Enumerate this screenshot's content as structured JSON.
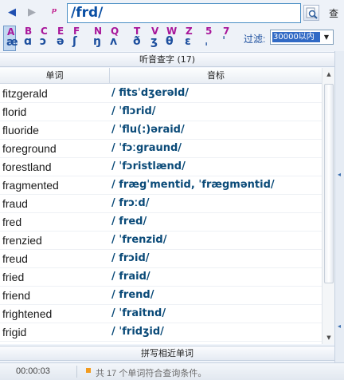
{
  "toolbar": {
    "search_value": "/frd/",
    "query_label": "查"
  },
  "phonetic_keys": [
    {
      "top": "A",
      "bottom": "æ",
      "active": true
    },
    {
      "top": "B",
      "bottom": "ɑ"
    },
    {
      "top": "C",
      "bottom": "ɔ"
    },
    {
      "top": "E",
      "bottom": "ə"
    },
    {
      "top": "F",
      "bottom": "ʃ"
    },
    {
      "top": "N",
      "bottom": "ŋ"
    },
    {
      "top": "Q",
      "bottom": "ʌ"
    },
    {
      "top": "T",
      "bottom": "ð"
    },
    {
      "top": "V",
      "bottom": "ʒ"
    },
    {
      "top": "W",
      "bottom": "θ"
    },
    {
      "top": "Z",
      "bottom": "ε"
    },
    {
      "top": "5",
      "bottom": "ˌ"
    },
    {
      "top": "7",
      "bottom": "ˈ"
    }
  ],
  "filter": {
    "label": "过滤:",
    "selected": "30000以内"
  },
  "results_header": "听音查字 (17)",
  "table": {
    "columns": [
      "单词",
      "音标"
    ],
    "rows": [
      {
        "word": "fitzgerald",
        "phonetic": "/ fitsˈdʒerəld/"
      },
      {
        "word": "florid",
        "phonetic": "/ ˈflɔrid/"
      },
      {
        "word": "fluoride",
        "phonetic": "/ ˈflu(:)əraid/"
      },
      {
        "word": "foreground",
        "phonetic": "/ ˈfɔːgraund/"
      },
      {
        "word": "forestland",
        "phonetic": "/ ˈfɔristlænd/"
      },
      {
        "word": "fragmented",
        "phonetic": "/ frægˈmentid, ˈfrægməntid/"
      },
      {
        "word": "fraud",
        "phonetic": "/ frɔːd/"
      },
      {
        "word": "fred",
        "phonetic": "/ fred/"
      },
      {
        "word": "frenzied",
        "phonetic": "/ ˈfrenzid/"
      },
      {
        "word": "freud",
        "phonetic": "/ frɔid/"
      },
      {
        "word": "fried",
        "phonetic": "/ fraid/"
      },
      {
        "word": "friend",
        "phonetic": "/ frend/"
      },
      {
        "word": "frightened",
        "phonetic": "/ ˈfraitnd/"
      },
      {
        "word": "frigid",
        "phonetic": "/ ˈfridʒid/"
      }
    ]
  },
  "similar_header": "拼写相近单词",
  "status": {
    "time": "00:00:03",
    "message": "共 17 个单词符合查询条件。"
  },
  "colors": {
    "accent": "#1d4f9e",
    "phonetic_text": "#0a4a78",
    "key_top": "#a8169a"
  }
}
